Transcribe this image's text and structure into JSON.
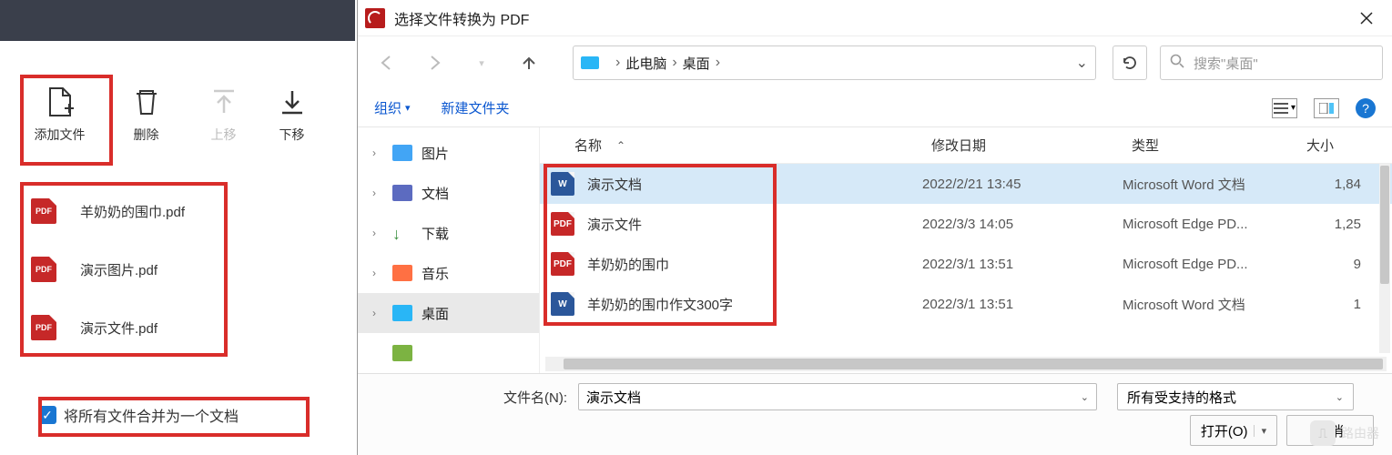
{
  "left": {
    "toolbar": {
      "add": "添加文件",
      "delete": "删除",
      "up": "上移",
      "down": "下移"
    },
    "files": [
      {
        "name": "羊奶奶的围巾.pdf"
      },
      {
        "name": "演示图片.pdf"
      },
      {
        "name": "演示文件.pdf"
      }
    ],
    "merge_label": "将所有文件合并为一个文档"
  },
  "dialog": {
    "title": "选择文件转换为 PDF",
    "breadcrumb": {
      "root": "此电脑",
      "folder": "桌面"
    },
    "search_placeholder": "搜索\"桌面\"",
    "commands": {
      "organize": "组织",
      "new_folder": "新建文件夹"
    },
    "sidebar": [
      {
        "label": "图片",
        "expander": "›",
        "glyph": "g-pic"
      },
      {
        "label": "文档",
        "expander": "›",
        "glyph": "g-doc"
      },
      {
        "label": "下载",
        "expander": "›",
        "glyph": "g-dl"
      },
      {
        "label": "音乐",
        "expander": "›",
        "glyph": "g-mus"
      },
      {
        "label": "桌面",
        "expander": "›",
        "glyph": "g-desk",
        "selected": true
      },
      {
        "label": "",
        "expander": "",
        "glyph": "g-green"
      }
    ],
    "columns": {
      "name": "名称",
      "date": "修改日期",
      "type": "类型",
      "size": "大小"
    },
    "files": [
      {
        "name": "演示文档",
        "date": "2022/2/21 13:45",
        "type": "Microsoft Word 文档",
        "size": "1,84",
        "icon": "word",
        "selected": true
      },
      {
        "name": "演示文件",
        "date": "2022/3/3 14:05",
        "type": "Microsoft Edge PD...",
        "size": "1,25",
        "icon": "pdf"
      },
      {
        "name": "羊奶奶的围巾",
        "date": "2022/3/1 13:51",
        "type": "Microsoft Edge PD...",
        "size": "9",
        "icon": "pdf"
      },
      {
        "name": "羊奶奶的围巾作文300字",
        "date": "2022/3/1 13:51",
        "type": "Microsoft Word 文档",
        "size": "1",
        "icon": "word"
      }
    ],
    "filename_label": "文件名(N):",
    "filename_value": "演示文档",
    "filter_label": "所有受支持的格式",
    "open_btn": "打开(O)",
    "cancel_btn": "取消"
  },
  "watermark": "路由器"
}
